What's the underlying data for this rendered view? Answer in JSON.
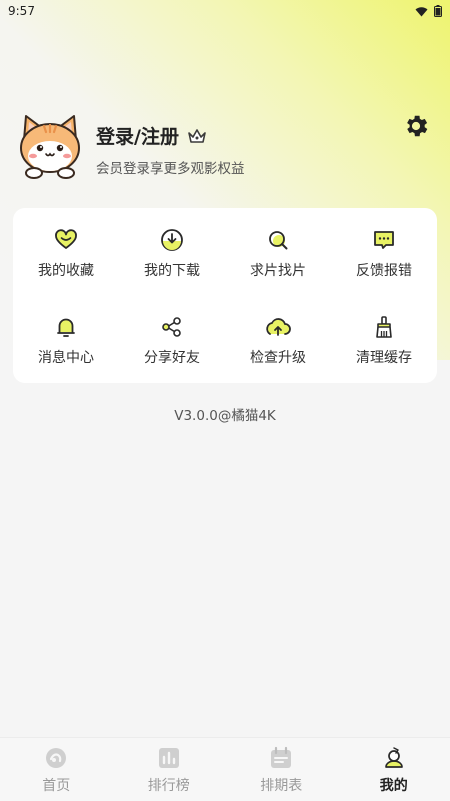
{
  "status_bar": {
    "time": "9:57"
  },
  "profile": {
    "title": "登录/注册",
    "subtitle": "会员登录享更多观影权益"
  },
  "menu": {
    "items": [
      {
        "label": "我的收藏",
        "icon": "heart-icon"
      },
      {
        "label": "我的下载",
        "icon": "download-icon"
      },
      {
        "label": "求片找片",
        "icon": "search-icon"
      },
      {
        "label": "反馈报错",
        "icon": "feedback-icon"
      },
      {
        "label": "消息中心",
        "icon": "bell-icon"
      },
      {
        "label": "分享好友",
        "icon": "share-icon"
      },
      {
        "label": "检查升级",
        "icon": "upgrade-icon"
      },
      {
        "label": "清理缓存",
        "icon": "broom-icon"
      }
    ]
  },
  "version": "V3.0.0@橘猫4K",
  "tabbar": {
    "tabs": [
      {
        "label": "首页",
        "icon": "home-icon"
      },
      {
        "label": "排行榜",
        "icon": "ranking-icon"
      },
      {
        "label": "排期表",
        "icon": "calendar-icon"
      },
      {
        "label": "我的",
        "icon": "profile-icon",
        "active": true
      }
    ]
  },
  "colors": {
    "accent": "#e6f25a",
    "card": "#ffffff",
    "background": "#f5f5f5"
  }
}
